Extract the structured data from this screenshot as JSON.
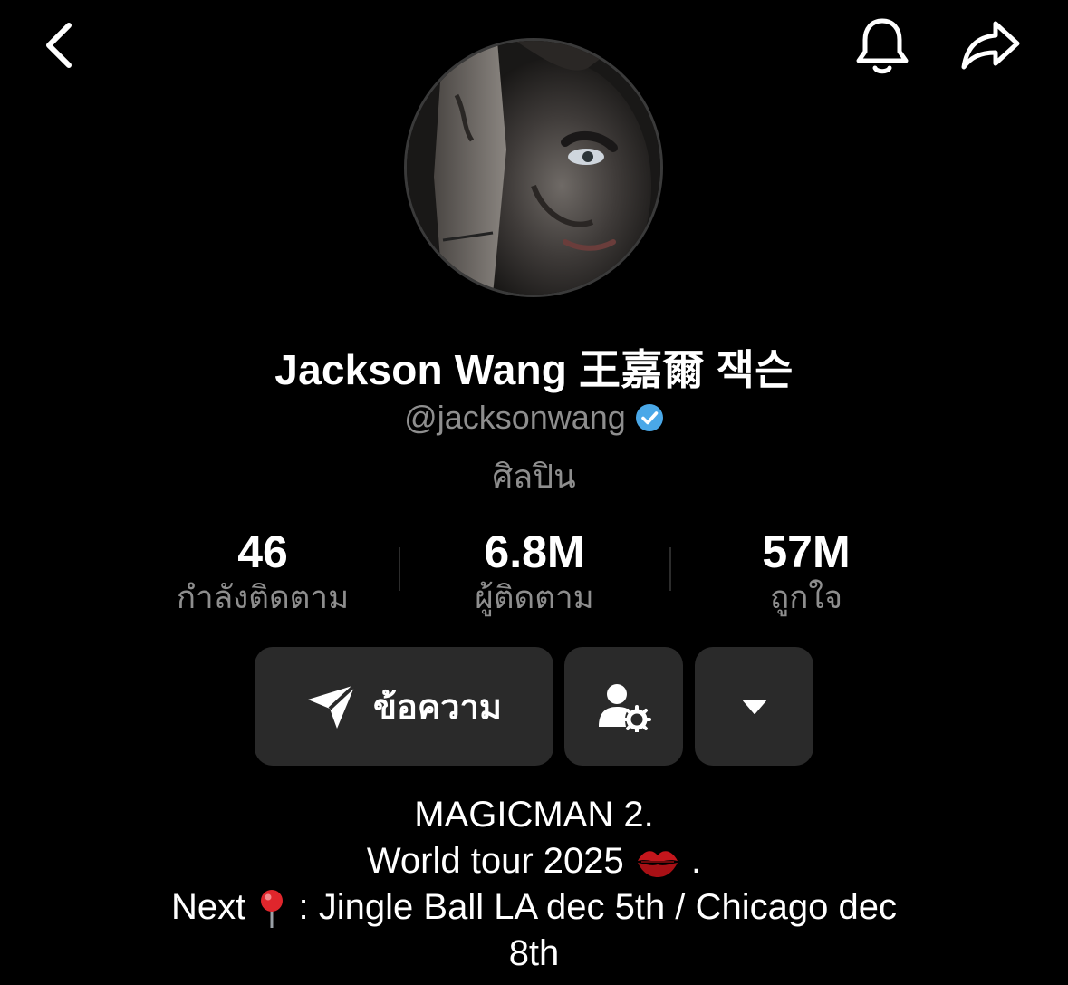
{
  "header": {
    "back_icon": "chevron-left-icon",
    "bell_icon": "bell-icon",
    "share_icon": "share-arrow-icon"
  },
  "profile": {
    "display_name": "Jackson Wang 王嘉爾 잭슨",
    "handle": "@jacksonwang",
    "verified": true,
    "verified_color": "#4aa8e8",
    "category": "ศิลปิน"
  },
  "stats": [
    {
      "value": "46",
      "label": "กำลังติดตาม"
    },
    {
      "value": "6.8M",
      "label": "ผู้ติดตาม"
    },
    {
      "value": "57M",
      "label": "ถูกใจ"
    }
  ],
  "actions": {
    "message_label": "ข้อความ",
    "message_icon": "send-icon",
    "friend_icon": "user-settings-icon",
    "more_icon": "caret-down-icon"
  },
  "bio": {
    "line1": "MAGICMAN 2.",
    "line2_text": "World tour 2025 ",
    "line2_emoji": "kiss-mark-icon",
    "line2_end": " .",
    "line3_start": "Next",
    "line3_emoji": "round-pushpin-icon",
    "line3_end": " : Jingle Ball LA dec 5th / Chicago dec",
    "line4": "8th"
  },
  "colors": {
    "background": "#000000",
    "button_bg": "#2a2a2a",
    "secondary_text": "#8e8e8e"
  }
}
